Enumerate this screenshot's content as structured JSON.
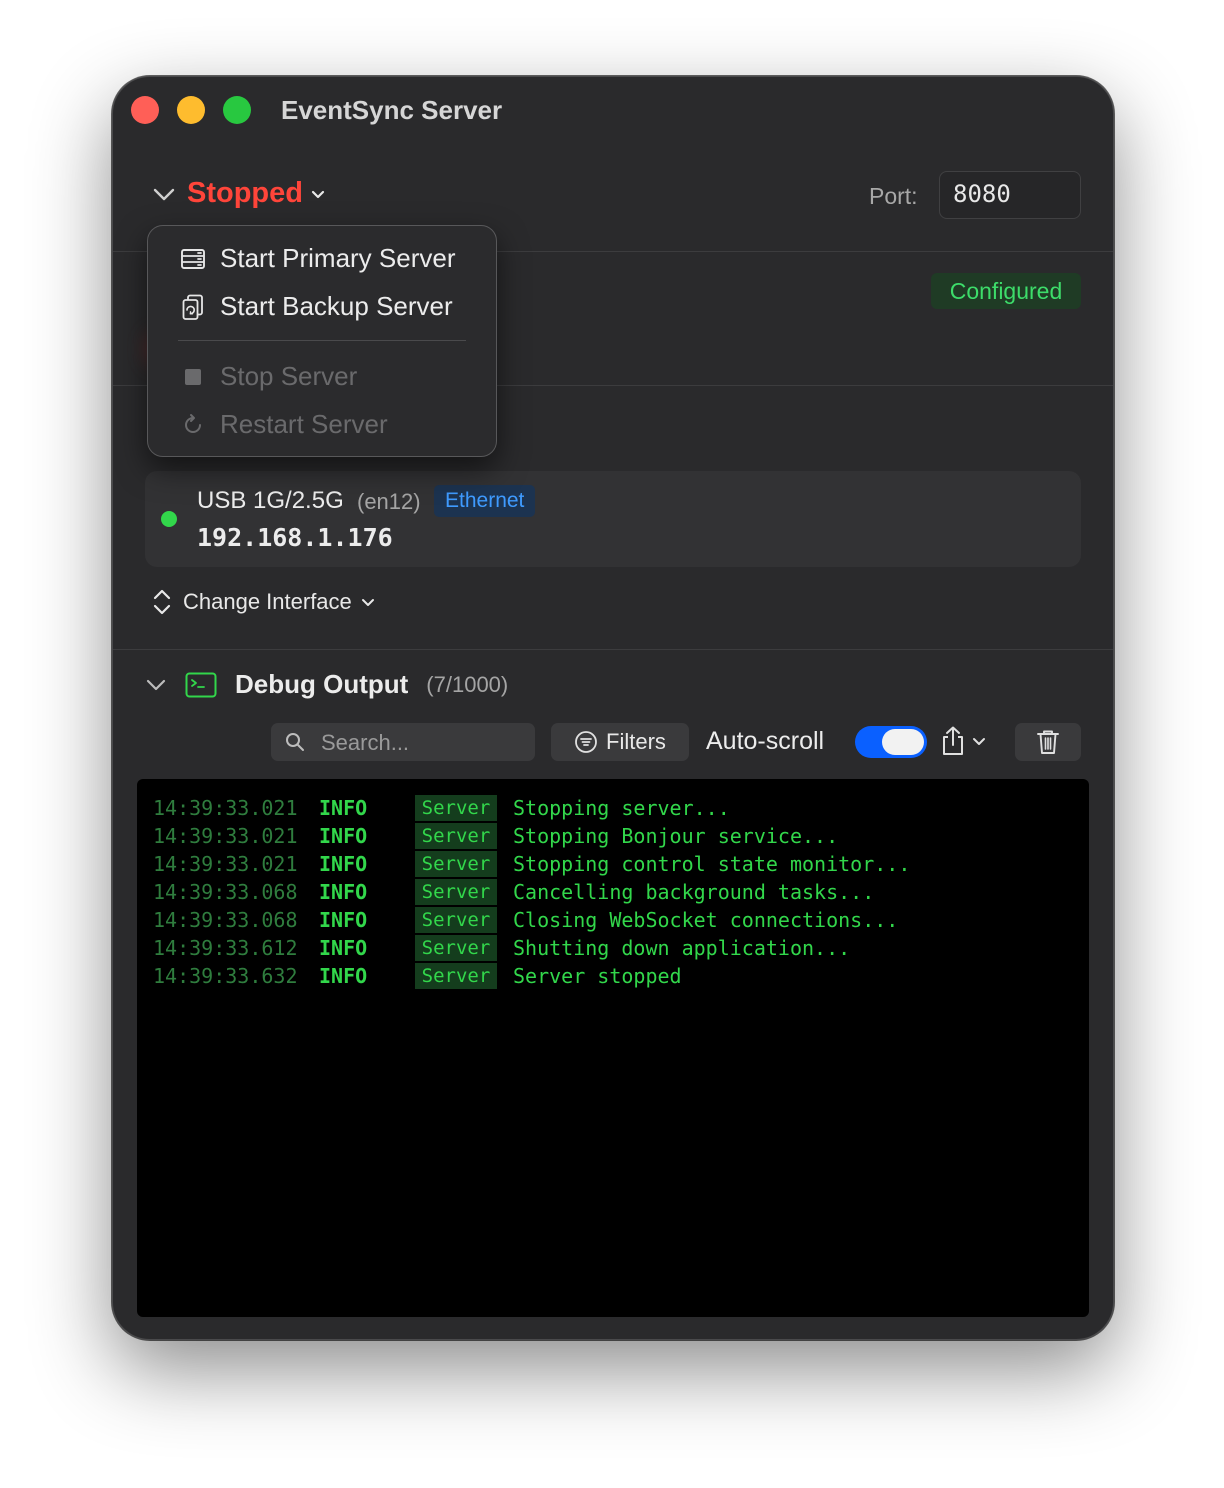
{
  "window": {
    "title": "EventSync Server"
  },
  "server": {
    "status": "Stopped",
    "port_label": "Port:",
    "port_value": "8080",
    "config_badge": "Configured"
  },
  "menu": {
    "items": [
      {
        "label": "Start Primary Server",
        "icon": "server-rack-icon",
        "enabled": true
      },
      {
        "label": "Start Backup Server",
        "icon": "backup-server-icon",
        "enabled": true
      },
      {
        "label": "Stop Server",
        "icon": "stop-square-icon",
        "enabled": false
      },
      {
        "label": "Restart Server",
        "icon": "restart-arrow-icon",
        "enabled": false
      }
    ]
  },
  "interface": {
    "name": "USB 1G/2.5G",
    "device": "(en12)",
    "type": "Ethernet",
    "ip": "192.168.1.176",
    "change_label": "Change Interface"
  },
  "debug": {
    "title": "Debug Output",
    "count": "(7/1000)",
    "search_placeholder": "Search...",
    "filters_label": "Filters",
    "autoscroll_label": "Auto-scroll",
    "autoscroll_on": true,
    "logs": [
      {
        "time": "14:39:33.021",
        "level": "INFO",
        "source": "Server",
        "message": "Stopping server..."
      },
      {
        "time": "14:39:33.021",
        "level": "INFO",
        "source": "Server",
        "message": "Stopping Bonjour service..."
      },
      {
        "time": "14:39:33.021",
        "level": "INFO",
        "source": "Server",
        "message": "Stopping control state monitor..."
      },
      {
        "time": "14:39:33.068",
        "level": "INFO",
        "source": "Server",
        "message": "Cancelling background tasks..."
      },
      {
        "time": "14:39:33.068",
        "level": "INFO",
        "source": "Server",
        "message": "Closing WebSocket connections..."
      },
      {
        "time": "14:39:33.612",
        "level": "INFO",
        "source": "Server",
        "message": "Shutting down application..."
      },
      {
        "time": "14:39:33.632",
        "level": "INFO",
        "source": "Server",
        "message": "Server stopped"
      }
    ]
  },
  "colors": {
    "status_stopped": "#ff453a",
    "accent_blue": "#0a60ff",
    "log_green": "#32d74b",
    "configured_green": "#3ddc6a"
  }
}
